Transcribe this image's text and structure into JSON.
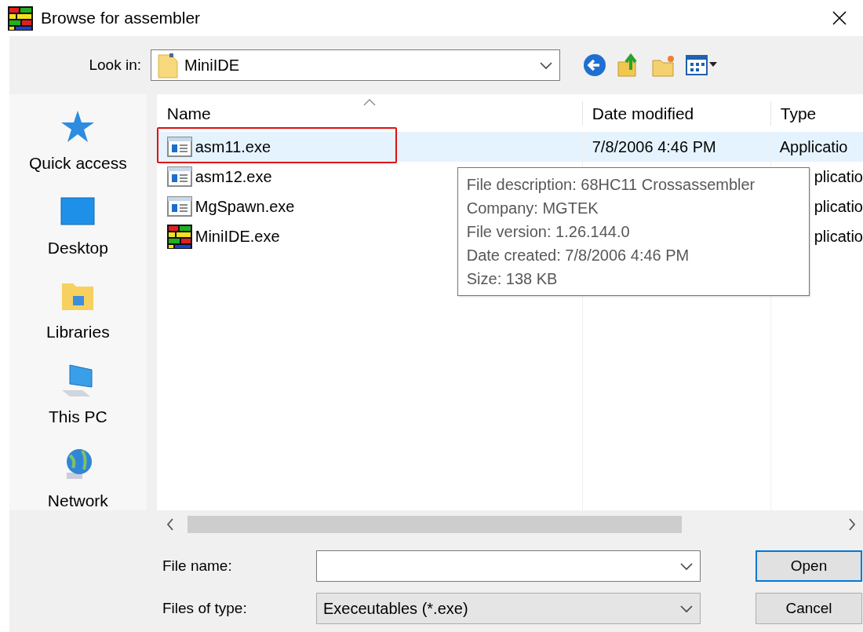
{
  "window": {
    "title": "Browse for assembler"
  },
  "look_in": {
    "label": "Look in:",
    "value": "MiniIDE"
  },
  "places": [
    {
      "label": "Quick access",
      "kind": "star"
    },
    {
      "label": "Desktop",
      "kind": "desktop"
    },
    {
      "label": "Libraries",
      "kind": "libraries"
    },
    {
      "label": "This PC",
      "kind": "pc"
    },
    {
      "label": "Network",
      "kind": "network"
    }
  ],
  "columns": [
    {
      "label": "Name",
      "sorted": true
    },
    {
      "label": "Date modified",
      "sorted": false
    },
    {
      "label": "Type",
      "sorted": false
    }
  ],
  "files": [
    {
      "name": "asm11.exe",
      "kind": "exe",
      "date": "7/8/2006 4:46 PM",
      "type": "Applicatio",
      "selected": true,
      "annotated": true
    },
    {
      "name": "asm12.exe",
      "kind": "exe",
      "type": "plicatio",
      "selected": false,
      "annotated": false
    },
    {
      "name": "MgSpawn.exe",
      "kind": "exe",
      "type": "plicatio",
      "selected": false,
      "annotated": false
    },
    {
      "name": "MiniIDE.exe",
      "kind": "app",
      "type": "plicatio",
      "selected": false,
      "annotated": false
    }
  ],
  "tooltip": {
    "lines": [
      "File description: 68HC11 Crossassembler",
      "Company: MGTEK",
      "File version: 1.26.144.0",
      "Date created: 7/8/2006 4:46 PM",
      "Size: 138 KB"
    ]
  },
  "file_name": {
    "label": "File name:"
  },
  "file_type": {
    "label": "Files of type:",
    "value": "Execeutables (*.exe)"
  },
  "buttons": [
    {
      "label": "Open",
      "default": true
    },
    {
      "label": "Cancel",
      "default": false
    }
  ]
}
